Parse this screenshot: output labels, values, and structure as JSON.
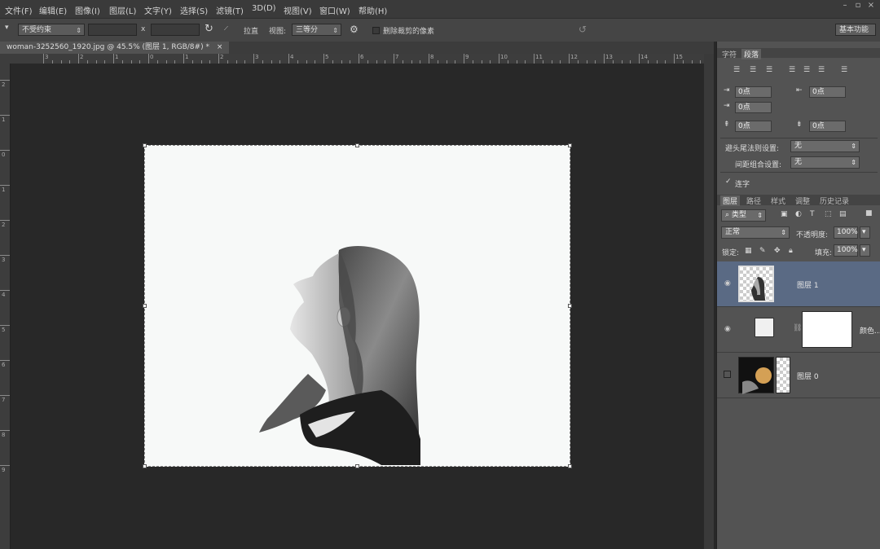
{
  "menu": {
    "items": [
      "文件(F)",
      "编辑(E)",
      "图像(I)",
      "图层(L)",
      "文字(Y)",
      "选择(S)",
      "滤镜(T)",
      "3D(D)",
      "视图(V)",
      "窗口(W)",
      "帮助(H)"
    ]
  },
  "options": {
    "preset": "不受约束",
    "swap_symbol": "x",
    "straighten_label": "拉直",
    "view_label": "视图:",
    "view_value": "三等分",
    "delete_cropped_label": "删除裁剪的像素",
    "workspace_label": "基本功能"
  },
  "document": {
    "tab_title": "woman-3252560_1920.jpg @ 45.5% (图层 1, RGB/8#) *",
    "close_symbol": "×",
    "hruler_labels": [
      "3",
      "2",
      "1",
      "0",
      "1",
      "2",
      "3",
      "4",
      "5",
      "6",
      "7",
      "8",
      "9",
      "10",
      "11",
      "12",
      "13",
      "14",
      "15"
    ],
    "vruler_labels": [
      "2",
      "1",
      "0",
      "1",
      "2",
      "3",
      "4",
      "5",
      "6",
      "7",
      "8",
      "9"
    ]
  },
  "char_panel": {
    "tabs": [
      "字符",
      "段落"
    ],
    "indent_left": "0点",
    "indent_right": "0点",
    "first_line": "0点",
    "space_before": "0点",
    "space_after": "0点",
    "kinsoku_label": "避头尾法则设置:",
    "kinsoku_value": "无",
    "mojikumi_label": "间距组合设置:",
    "mojikumi_value": "无",
    "hyphenate_label": "连字"
  },
  "layers_panel": {
    "tabs": [
      "图层",
      "路径",
      "样式",
      "调整",
      "历史记录"
    ],
    "filter_value": "类型",
    "blend_mode": "正常",
    "opacity_label": "不透明度:",
    "opacity_value": "100%",
    "lock_label": "锁定:",
    "fill_label": "填充:",
    "fill_value": "100%",
    "layers": [
      {
        "name": "图层 1",
        "selected": true
      },
      {
        "name": "颜色..."
      },
      {
        "name": "图层 0"
      }
    ]
  },
  "colors": {
    "selected_layer": "#5a6a84",
    "canvas": "#f7f9f8"
  }
}
